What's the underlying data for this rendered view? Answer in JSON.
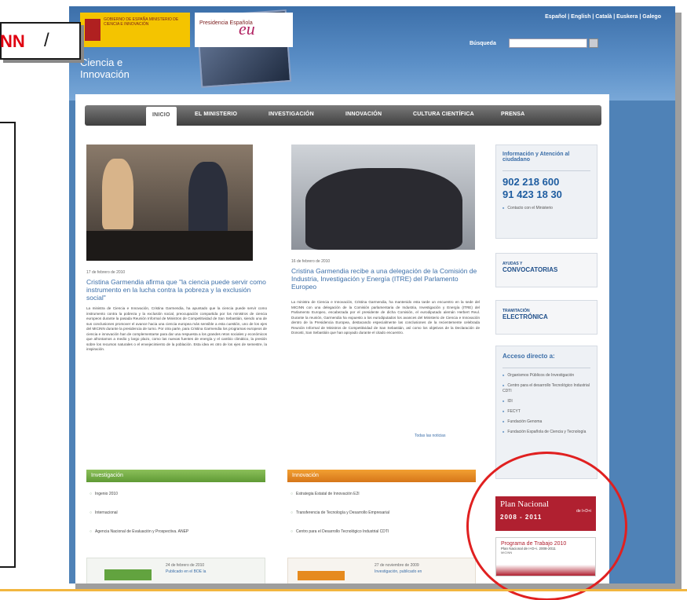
{
  "header": {
    "logo_gob": "GOBIERNO DE ESPAÑA  MINISTERIO DE CIENCIA E INNOVACIÓN",
    "logo_presidencia": "Presidencia Española",
    "logo_eu": "eu",
    "site_title_line1": "Ciencia e",
    "site_title_line2": "Innovación",
    "languages": "Español | English | Català | Euskera | Galego",
    "search_label": "Búsqueda"
  },
  "nav": {
    "items": [
      "INICIO",
      "EL MINISTERIO",
      "INVESTIGACIÓN",
      "INNOVACIÓN",
      "CULTURA CIENTÍFICA",
      "PRENSA"
    ]
  },
  "news": [
    {
      "date": "17 de febrero de 2010",
      "title": "Cristina Garmendia afirma que \"la ciencia puede servir como instrumento en la lucha contra la pobreza y la exclusión social\"",
      "body": "La ministra de Ciencia e Innovación, Cristina Garmendia, ha apuntado que la ciencia puede servir como instrumento contra la pobreza y la exclusión social, preocupación compartida por los ministros de ciencia europeos durante la pasada Reunión Informal de Ministros de Competitividad de San Sebastián, siendo una de sus conclusiones promover el avance hacia una ciencia europea más sensible a esta cuestión, uno de los ejes del MICINN durante la presidencia de turno. Por otra parte, para Cristina Garmendia los programas europeos de ciencia e innovación han de complementarse para dar una respuesta a los grandes retos sociales y económicos que afrontamos a medio y largo plazo, como las nuevas fuentes de energía y el cambio climático, la presión sobre los recursos naturales o el envejecimiento de la población. Esta idea es otro de los ejes de semestre, la inspiración."
    },
    {
      "date": "16 de febrero de 2010",
      "title": "Cristina Garmendia recibe a una delegación de la Comisión de Industria, Investigación y Energía (ITRE) del Parlamento Europeo",
      "body": "La ministra de Ciencia e Innovación, Cristina Garmendia, ha mantenido esta tarde un encuentro en la sede del MICINN con una delegación de la Comisión parlamentaria de Industria, Investigación y Energía (ITRE) del Parlamento Europeo, encabezada por el presidente de dicha Comisión, el eurodiputado alemán Herbert Reul. Durante la reunión, Garmendia ha expuesto a los eurodiputados los avances del Ministerio de Ciencia e Innovación dentro de la Presidencia Europea, destacando especialmente las conclusiones de la recientemente celebrada Reunión Informal de Ministros de Competitividad de San Sebastián, así como los objetivos de la Declaración de Donosti, San Sebastián que han apoyado durante el citado encuentro."
    }
  ],
  "all_news_link": "Todas las noticias",
  "sections": {
    "investigacion": {
      "title": "Investigación",
      "items": [
        "Ingenio 2010",
        "Internacional",
        "Agencia Nacional de Evaluación y Prospectiva. ANEP"
      ]
    },
    "innovacion": {
      "title": "Innovación",
      "items": [
        "Estrategia Estatal de Innovación E2I",
        "Transferencia de Tecnología y Desarrollo Empresarial",
        "Centro para el Desarrollo Tecnológico Industrial CDTI"
      ]
    }
  },
  "bottom_items": [
    {
      "date": "24 de febrero de 2010",
      "text": "Publicado en el BOE la"
    },
    {
      "date": "27 de noviembre de 2009",
      "text": "Investigación, publicado en"
    }
  ],
  "sidebar": {
    "info_title": "Información y Atención al ciudadano",
    "phone1": "902 218 600",
    "phone2": "91 423 18 30",
    "contact_link": "Contacto con el Ministerio",
    "ayudas_line1": "AYUDAS Y",
    "ayudas_line2": "CONVOCATORIAS",
    "tramitacion_line1": "TRAMITACIÓN",
    "tramitacion_line2": "ELECTRÓNICA",
    "acceso_title": "Acceso directo a:",
    "acceso_items": [
      "Organismos Públicos de Investigación",
      "Centro para el desarrollo Tecnológico Industrial CDTI",
      "IDI",
      "FECYT",
      "Fundación Genoma",
      "Fundación Española de Ciencia y Tecnología"
    ],
    "plan_title": "Plan Nacional",
    "plan_sub": "de I+D+i",
    "plan_years": "2008 - 2011",
    "programa_title": "Programa de Trabajo 2010",
    "programa_sub": "Plan Nacional de I+D+i. 2008-2011",
    "programa_note": "MICINN"
  },
  "callout": {
    "text": "NN",
    "slash": "/"
  }
}
